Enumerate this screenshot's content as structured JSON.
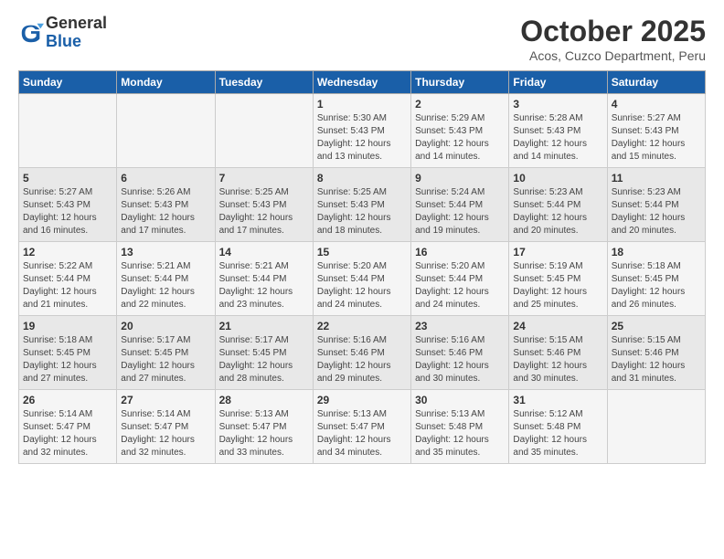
{
  "header": {
    "logo_general": "General",
    "logo_blue": "Blue",
    "month_title": "October 2025",
    "subtitle": "Acos, Cuzco Department, Peru"
  },
  "days_of_week": [
    "Sunday",
    "Monday",
    "Tuesday",
    "Wednesday",
    "Thursday",
    "Friday",
    "Saturday"
  ],
  "weeks": [
    [
      {
        "day": "",
        "sunrise": "",
        "sunset": "",
        "daylight": ""
      },
      {
        "day": "",
        "sunrise": "",
        "sunset": "",
        "daylight": ""
      },
      {
        "day": "",
        "sunrise": "",
        "sunset": "",
        "daylight": ""
      },
      {
        "day": "1",
        "sunrise": "Sunrise: 5:30 AM",
        "sunset": "Sunset: 5:43 PM",
        "daylight": "Daylight: 12 hours and 13 minutes."
      },
      {
        "day": "2",
        "sunrise": "Sunrise: 5:29 AM",
        "sunset": "Sunset: 5:43 PM",
        "daylight": "Daylight: 12 hours and 14 minutes."
      },
      {
        "day": "3",
        "sunrise": "Sunrise: 5:28 AM",
        "sunset": "Sunset: 5:43 PM",
        "daylight": "Daylight: 12 hours and 14 minutes."
      },
      {
        "day": "4",
        "sunrise": "Sunrise: 5:27 AM",
        "sunset": "Sunset: 5:43 PM",
        "daylight": "Daylight: 12 hours and 15 minutes."
      }
    ],
    [
      {
        "day": "5",
        "sunrise": "Sunrise: 5:27 AM",
        "sunset": "Sunset: 5:43 PM",
        "daylight": "Daylight: 12 hours and 16 minutes."
      },
      {
        "day": "6",
        "sunrise": "Sunrise: 5:26 AM",
        "sunset": "Sunset: 5:43 PM",
        "daylight": "Daylight: 12 hours and 17 minutes."
      },
      {
        "day": "7",
        "sunrise": "Sunrise: 5:25 AM",
        "sunset": "Sunset: 5:43 PM",
        "daylight": "Daylight: 12 hours and 17 minutes."
      },
      {
        "day": "8",
        "sunrise": "Sunrise: 5:25 AM",
        "sunset": "Sunset: 5:43 PM",
        "daylight": "Daylight: 12 hours and 18 minutes."
      },
      {
        "day": "9",
        "sunrise": "Sunrise: 5:24 AM",
        "sunset": "Sunset: 5:44 PM",
        "daylight": "Daylight: 12 hours and 19 minutes."
      },
      {
        "day": "10",
        "sunrise": "Sunrise: 5:23 AM",
        "sunset": "Sunset: 5:44 PM",
        "daylight": "Daylight: 12 hours and 20 minutes."
      },
      {
        "day": "11",
        "sunrise": "Sunrise: 5:23 AM",
        "sunset": "Sunset: 5:44 PM",
        "daylight": "Daylight: 12 hours and 20 minutes."
      }
    ],
    [
      {
        "day": "12",
        "sunrise": "Sunrise: 5:22 AM",
        "sunset": "Sunset: 5:44 PM",
        "daylight": "Daylight: 12 hours and 21 minutes."
      },
      {
        "day": "13",
        "sunrise": "Sunrise: 5:21 AM",
        "sunset": "Sunset: 5:44 PM",
        "daylight": "Daylight: 12 hours and 22 minutes."
      },
      {
        "day": "14",
        "sunrise": "Sunrise: 5:21 AM",
        "sunset": "Sunset: 5:44 PM",
        "daylight": "Daylight: 12 hours and 23 minutes."
      },
      {
        "day": "15",
        "sunrise": "Sunrise: 5:20 AM",
        "sunset": "Sunset: 5:44 PM",
        "daylight": "Daylight: 12 hours and 24 minutes."
      },
      {
        "day": "16",
        "sunrise": "Sunrise: 5:20 AM",
        "sunset": "Sunset: 5:44 PM",
        "daylight": "Daylight: 12 hours and 24 minutes."
      },
      {
        "day": "17",
        "sunrise": "Sunrise: 5:19 AM",
        "sunset": "Sunset: 5:45 PM",
        "daylight": "Daylight: 12 hours and 25 minutes."
      },
      {
        "day": "18",
        "sunrise": "Sunrise: 5:18 AM",
        "sunset": "Sunset: 5:45 PM",
        "daylight": "Daylight: 12 hours and 26 minutes."
      }
    ],
    [
      {
        "day": "19",
        "sunrise": "Sunrise: 5:18 AM",
        "sunset": "Sunset: 5:45 PM",
        "daylight": "Daylight: 12 hours and 27 minutes."
      },
      {
        "day": "20",
        "sunrise": "Sunrise: 5:17 AM",
        "sunset": "Sunset: 5:45 PM",
        "daylight": "Daylight: 12 hours and 27 minutes."
      },
      {
        "day": "21",
        "sunrise": "Sunrise: 5:17 AM",
        "sunset": "Sunset: 5:45 PM",
        "daylight": "Daylight: 12 hours and 28 minutes."
      },
      {
        "day": "22",
        "sunrise": "Sunrise: 5:16 AM",
        "sunset": "Sunset: 5:46 PM",
        "daylight": "Daylight: 12 hours and 29 minutes."
      },
      {
        "day": "23",
        "sunrise": "Sunrise: 5:16 AM",
        "sunset": "Sunset: 5:46 PM",
        "daylight": "Daylight: 12 hours and 30 minutes."
      },
      {
        "day": "24",
        "sunrise": "Sunrise: 5:15 AM",
        "sunset": "Sunset: 5:46 PM",
        "daylight": "Daylight: 12 hours and 30 minutes."
      },
      {
        "day": "25",
        "sunrise": "Sunrise: 5:15 AM",
        "sunset": "Sunset: 5:46 PM",
        "daylight": "Daylight: 12 hours and 31 minutes."
      }
    ],
    [
      {
        "day": "26",
        "sunrise": "Sunrise: 5:14 AM",
        "sunset": "Sunset: 5:47 PM",
        "daylight": "Daylight: 12 hours and 32 minutes."
      },
      {
        "day": "27",
        "sunrise": "Sunrise: 5:14 AM",
        "sunset": "Sunset: 5:47 PM",
        "daylight": "Daylight: 12 hours and 32 minutes."
      },
      {
        "day": "28",
        "sunrise": "Sunrise: 5:13 AM",
        "sunset": "Sunset: 5:47 PM",
        "daylight": "Daylight: 12 hours and 33 minutes."
      },
      {
        "day": "29",
        "sunrise": "Sunrise: 5:13 AM",
        "sunset": "Sunset: 5:47 PM",
        "daylight": "Daylight: 12 hours and 34 minutes."
      },
      {
        "day": "30",
        "sunrise": "Sunrise: 5:13 AM",
        "sunset": "Sunset: 5:48 PM",
        "daylight": "Daylight: 12 hours and 35 minutes."
      },
      {
        "day": "31",
        "sunrise": "Sunrise: 5:12 AM",
        "sunset": "Sunset: 5:48 PM",
        "daylight": "Daylight: 12 hours and 35 minutes."
      },
      {
        "day": "",
        "sunrise": "",
        "sunset": "",
        "daylight": ""
      }
    ]
  ]
}
